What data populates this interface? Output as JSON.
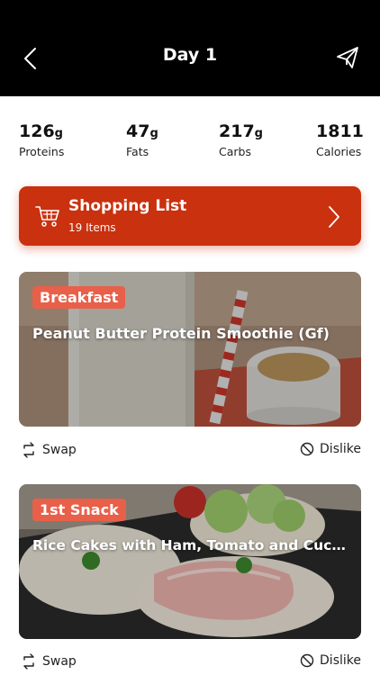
{
  "header": {
    "title": "Day 1",
    "back_icon": "chevron-left-icon",
    "share_icon": "paper-plane-icon"
  },
  "macros": [
    {
      "value": "126",
      "unit": "g",
      "label": "Proteins"
    },
    {
      "value": "47",
      "unit": "g",
      "label": "Fats"
    },
    {
      "value": "217",
      "unit": "g",
      "label": "Carbs"
    },
    {
      "value": "1811",
      "unit": "",
      "label": "Calories"
    }
  ],
  "shopping": {
    "title": "Shopping List",
    "count": "19 Items",
    "icon": "cart-icon",
    "accent": "#c9310f"
  },
  "meals": [
    {
      "tag": "Breakfast",
      "name": "Peanut Butter Protein Smoothie (Gf)"
    },
    {
      "tag": "1st Snack",
      "name": "Rice Cakes with Ham, Tomato and Cucumber"
    }
  ],
  "actions": {
    "swap": "Swap",
    "dislike": "Dislike"
  },
  "colors": {
    "header_bg": "#000000",
    "tag_bg": "#e8604a"
  }
}
